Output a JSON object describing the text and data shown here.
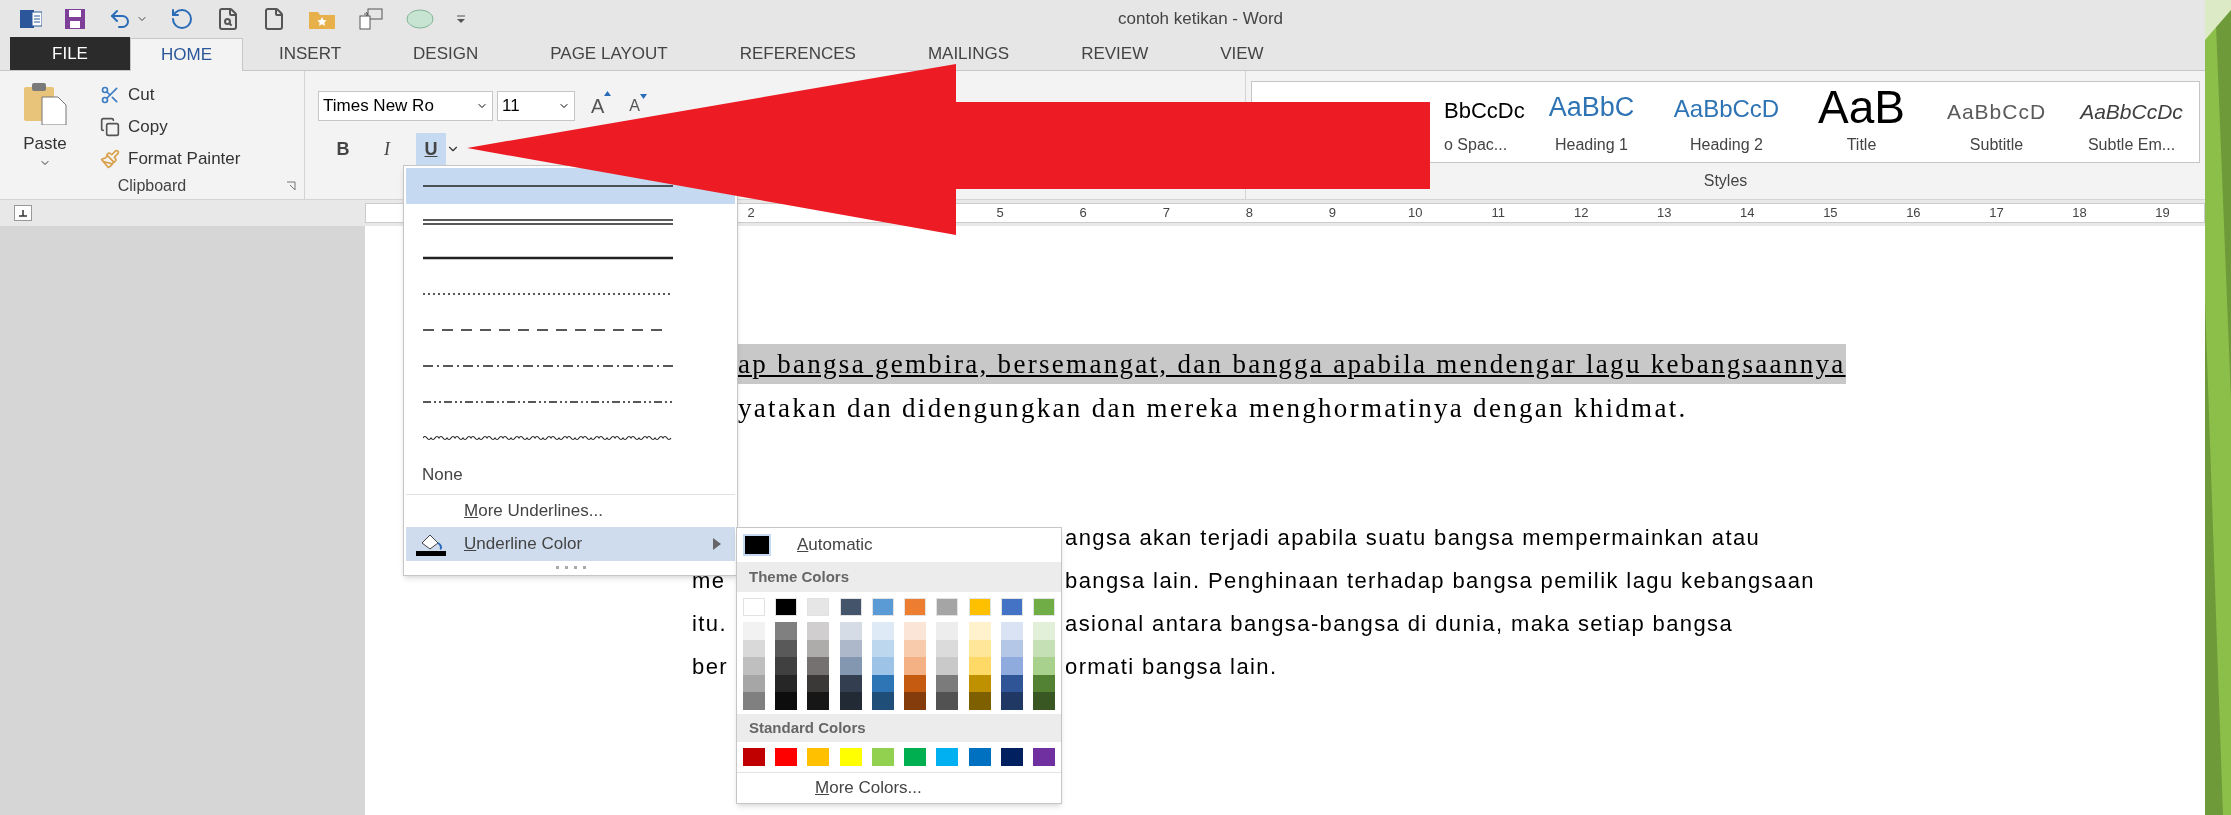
{
  "window": {
    "title": "contoh ketikan - Word"
  },
  "tabs": [
    {
      "label": "FILE",
      "kind": "file",
      "selected": false
    },
    {
      "label": "HOME",
      "kind": "tab",
      "selected": true
    },
    {
      "label": "INSERT",
      "kind": "tab",
      "selected": false
    },
    {
      "label": "DESIGN",
      "kind": "tab",
      "selected": false
    },
    {
      "label": "PAGE LAYOUT",
      "kind": "tab",
      "selected": false
    },
    {
      "label": "REFERENCES",
      "kind": "tab",
      "selected": false
    },
    {
      "label": "MAILINGS",
      "kind": "tab",
      "selected": false
    },
    {
      "label": "REVIEW",
      "kind": "tab",
      "selected": false
    },
    {
      "label": "VIEW",
      "kind": "tab",
      "selected": false
    }
  ],
  "clipboard": {
    "paste": "Paste",
    "cut": "Cut",
    "copy": "Copy",
    "format_painter": "Format Painter",
    "group_label": "Clipboard"
  },
  "font": {
    "name": "Times New Ro",
    "size": "11",
    "grow": "A",
    "shrink": "A",
    "toggles": [
      {
        "label": "B",
        "kind": "bold",
        "on": false
      },
      {
        "label": "I",
        "kind": "italic",
        "on": false
      },
      {
        "label": "U",
        "kind": "underline",
        "on": true
      }
    ]
  },
  "styles": {
    "group_label": "Styles",
    "items": [
      {
        "preview": "BbCcDc",
        "label": "o Spac...",
        "kind": "body"
      },
      {
        "preview": "AaBbC",
        "label": "Heading 1",
        "kind": "heading1"
      },
      {
        "preview": "AaBbCcD",
        "label": "Heading 2",
        "kind": "heading2"
      },
      {
        "preview": "AaB",
        "label": "Title",
        "kind": "title"
      },
      {
        "preview": "AaBbCcD",
        "label": "Subtitle",
        "kind": "subtitle"
      },
      {
        "preview": "AaBbCcDc",
        "label": "Subtle Em...",
        "kind": "emphasis"
      }
    ]
  },
  "ruler": {
    "left_numbers": [
      "2"
    ],
    "right_numbers": [
      "5",
      "6",
      "7",
      "8",
      "9",
      "10",
      "11",
      "12",
      "13",
      "14",
      "15",
      "16",
      "17",
      "18",
      "19"
    ]
  },
  "document": {
    "paragraph_1": [
      {
        "text": "ap bangsa gembira, bersemangat, dan bangga apabila mendengar lagu kebangsaannya",
        "selected": true
      },
      {
        "text": "yatakan dan didengungkan dan mereka menghormatinya dengan khidmat.",
        "selected": false
      }
    ],
    "paragraph_2": [
      {
        "right": "angsa akan terjadi apabila suatu bangsa mempermainkan atau"
      },
      {
        "left": "me",
        "right": "bangsa lain. Penghinaan terhadap bangsa pemilik lagu kebangsaan"
      },
      {
        "left": "itu.",
        "right": "asional antara bangsa-bangsa di dunia, maka setiap bangsa"
      },
      {
        "left": "ber",
        "right": "ormati bangsa lain."
      }
    ]
  },
  "underline_menu": {
    "styles": [
      {
        "kind": "solid",
        "selected": true
      },
      {
        "kind": "double",
        "selected": false
      },
      {
        "kind": "thick",
        "selected": false
      },
      {
        "kind": "dotted",
        "selected": false
      },
      {
        "kind": "dashed",
        "selected": false
      },
      {
        "kind": "dash-dot",
        "selected": false
      },
      {
        "kind": "dash-dot-dot",
        "selected": false
      },
      {
        "kind": "wave",
        "selected": false
      }
    ],
    "none": "None",
    "more": "More Underlines...",
    "color": {
      "label": "Underline Color",
      "expanded": true
    }
  },
  "color_menu": {
    "automatic": {
      "label": "Automatic",
      "color": "#000000"
    },
    "theme_header": "Theme Colors",
    "theme_colors": [
      {
        "color": "#ffffff",
        "shades": [
          {
            "color": "#f2f2f2"
          },
          {
            "color": "#d9d9d9"
          },
          {
            "color": "#bfbfbf"
          },
          {
            "color": "#a6a6a6"
          },
          {
            "color": "#808080"
          }
        ]
      },
      {
        "color": "#000000",
        "shades": [
          {
            "color": "#808080"
          },
          {
            "color": "#595959"
          },
          {
            "color": "#404040"
          },
          {
            "color": "#262626"
          },
          {
            "color": "#0d0d0d"
          }
        ]
      },
      {
        "color": "#e7e6e6",
        "shades": [
          {
            "color": "#d0cece"
          },
          {
            "color": "#aeabab"
          },
          {
            "color": "#767171"
          },
          {
            "color": "#3b3838"
          },
          {
            "color": "#161616"
          }
        ]
      },
      {
        "color": "#44546a",
        "shades": [
          {
            "color": "#d6dce5"
          },
          {
            "color": "#adb9ca"
          },
          {
            "color": "#8497b0"
          },
          {
            "color": "#333f50"
          },
          {
            "color": "#222a35"
          }
        ]
      },
      {
        "color": "#5b9bd5",
        "shades": [
          {
            "color": "#deebf7"
          },
          {
            "color": "#bdd7ee"
          },
          {
            "color": "#9dc3e6"
          },
          {
            "color": "#2e75b6"
          },
          {
            "color": "#1f4e79"
          }
        ]
      },
      {
        "color": "#ed7d31",
        "shades": [
          {
            "color": "#fbe5d6"
          },
          {
            "color": "#f8cbad"
          },
          {
            "color": "#f4b183"
          },
          {
            "color": "#c55a11"
          },
          {
            "color": "#843c0c"
          }
        ]
      },
      {
        "color": "#a5a5a5",
        "shades": [
          {
            "color": "#ededed"
          },
          {
            "color": "#dbdbdb"
          },
          {
            "color": "#c9c9c9"
          },
          {
            "color": "#7b7b7b"
          },
          {
            "color": "#525252"
          }
        ]
      },
      {
        "color": "#ffc000",
        "shades": [
          {
            "color": "#fff2cc"
          },
          {
            "color": "#ffe699"
          },
          {
            "color": "#ffd966"
          },
          {
            "color": "#bf9000"
          },
          {
            "color": "#7f6000"
          }
        ]
      },
      {
        "color": "#4472c4",
        "shades": [
          {
            "color": "#dae3f3"
          },
          {
            "color": "#b4c7e7"
          },
          {
            "color": "#8faadc"
          },
          {
            "color": "#2f5597"
          },
          {
            "color": "#203864"
          }
        ]
      },
      {
        "color": "#70ad47",
        "shades": [
          {
            "color": "#e2f0d9"
          },
          {
            "color": "#c5e0b4"
          },
          {
            "color": "#a9d18e"
          },
          {
            "color": "#548235"
          },
          {
            "color": "#385723"
          }
        ]
      }
    ],
    "standard_header": "Standard Colors",
    "standard_colors": [
      {
        "color": "#c00000"
      },
      {
        "color": "#ff0000"
      },
      {
        "color": "#ffc000"
      },
      {
        "color": "#ffff00"
      },
      {
        "color": "#92d050"
      },
      {
        "color": "#00b050"
      },
      {
        "color": "#00b0f0"
      },
      {
        "color": "#0070c0"
      },
      {
        "color": "#002060"
      },
      {
        "color": "#7030a0"
      }
    ],
    "more": "More Colors..."
  }
}
